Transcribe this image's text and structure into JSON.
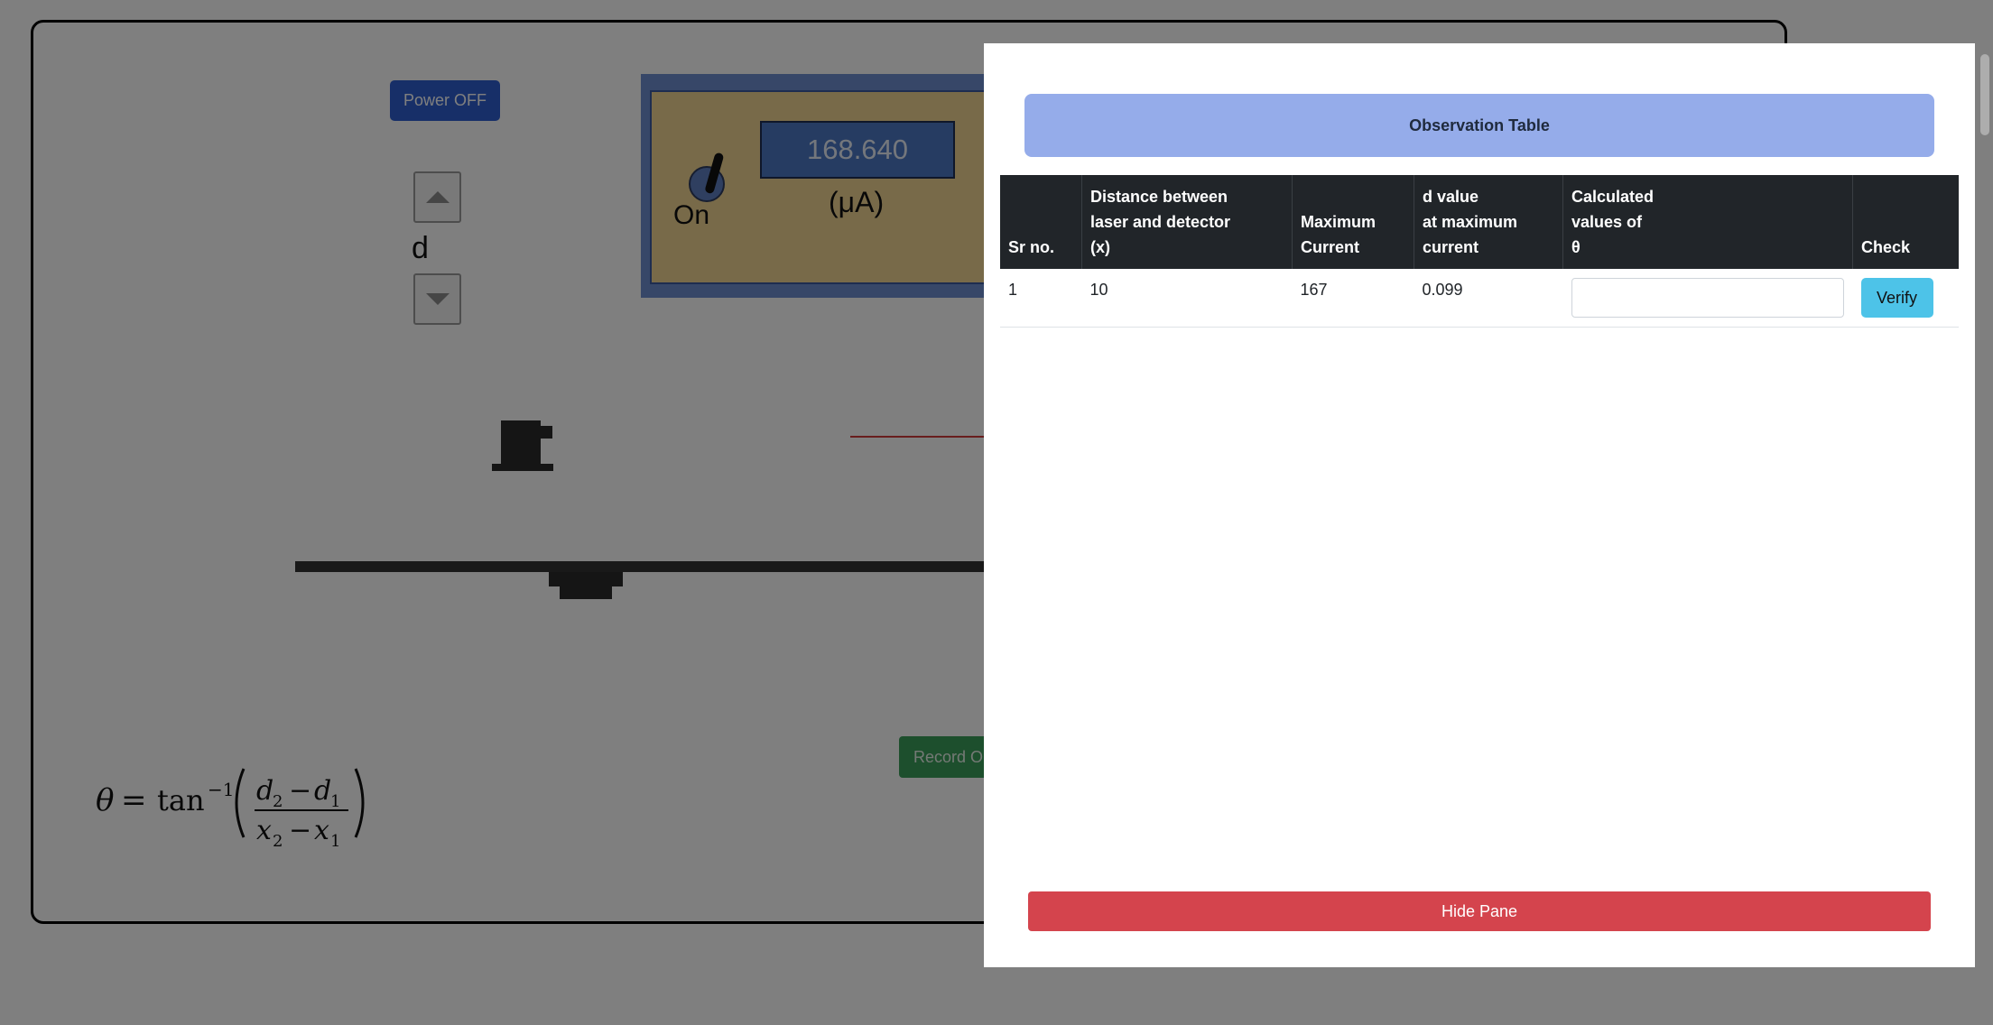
{
  "simulation": {
    "power_button_label": "Power OFF",
    "d_label": "d",
    "meter": {
      "reading": "168.640",
      "unit": "(μA)",
      "switch_label": "On"
    },
    "record_button_label": "Record Observation"
  },
  "observation_panel": {
    "header": "Observation Table",
    "columns": [
      {
        "line1": "Sr no.",
        "line2": "",
        "line3": ""
      },
      {
        "line1": "Distance between",
        "line2": "laser and detector",
        "line3": "(x)"
      },
      {
        "line1": "Maximum",
        "line2": "Current",
        "line3": ""
      },
      {
        "line1": "d value",
        "line2": "at maximum",
        "line3": "current"
      },
      {
        "line1": "Calculated",
        "line2": "values of",
        "line3": "θ"
      },
      {
        "line1": "Check",
        "line2": "",
        "line3": ""
      }
    ],
    "rows": [
      {
        "sr": "1",
        "distance": "10",
        "max_current": "167",
        "d_value": "0.099",
        "theta_value": "",
        "check_label": "Verify"
      }
    ],
    "hide_button_label": "Hide Pane"
  },
  "colors": {
    "power_button": "#2f5fd0",
    "header_bg": "#95acea",
    "table_head_bg": "#212529",
    "verify_button": "#4dc3e8",
    "hide_button": "#d4444d",
    "record_button": "#3a9e5a",
    "laser_beam": "#d03a3a"
  }
}
